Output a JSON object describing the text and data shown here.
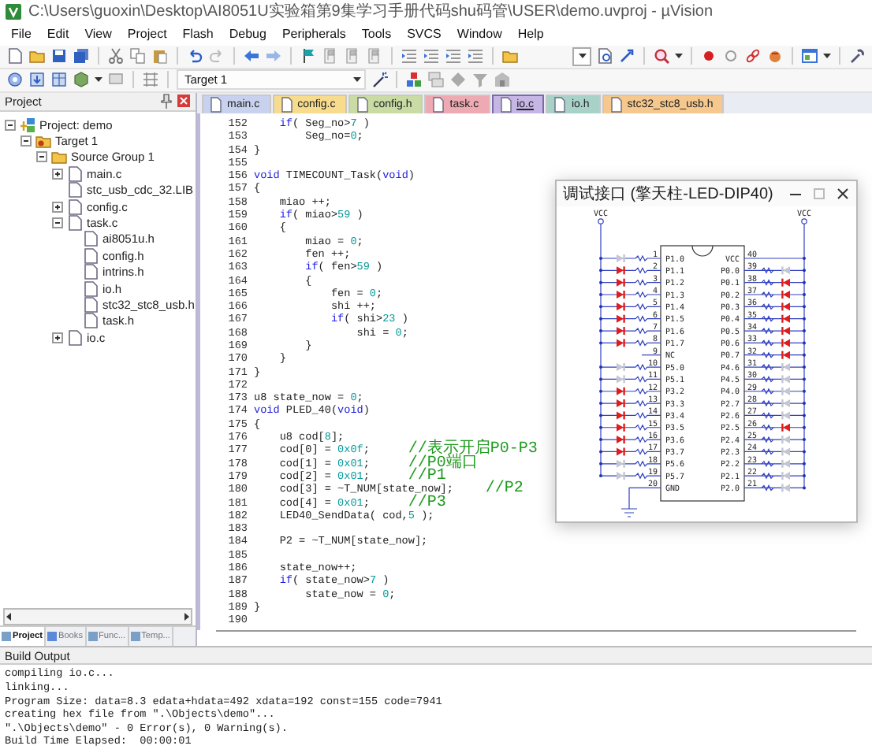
{
  "window": {
    "title": "C:\\Users\\guoxin\\Desktop\\AI8051U实验箱第9集学习手册代码shu码管\\USER\\demo.uvproj - µVision"
  },
  "menu": [
    "File",
    "Edit",
    "View",
    "Project",
    "Flash",
    "Debug",
    "Peripherals",
    "Tools",
    "SVCS",
    "Window",
    "Help"
  ],
  "toolbar": {
    "target": "Target 1"
  },
  "project_panel": {
    "title": "Project",
    "tree": [
      {
        "label": "Project: demo",
        "kind": "project",
        "expanded": true,
        "children": [
          {
            "label": "Target 1",
            "kind": "target",
            "expanded": true,
            "children": [
              {
                "label": "Source Group 1",
                "kind": "group",
                "expanded": true,
                "children": [
                  {
                    "label": "main.c",
                    "kind": "file",
                    "expanded": false
                  },
                  {
                    "label": "stc_usb_cdc_32.LIB",
                    "kind": "file"
                  },
                  {
                    "label": "config.c",
                    "kind": "file",
                    "expanded": false
                  },
                  {
                    "label": "task.c",
                    "kind": "file",
                    "expanded": true,
                    "children": [
                      {
                        "label": "ai8051u.h",
                        "kind": "file"
                      },
                      {
                        "label": "config.h",
                        "kind": "file"
                      },
                      {
                        "label": "intrins.h",
                        "kind": "file"
                      },
                      {
                        "label": "io.h",
                        "kind": "file"
                      },
                      {
                        "label": "stc32_stc8_usb.h",
                        "kind": "file"
                      },
                      {
                        "label": "task.h",
                        "kind": "file"
                      }
                    ]
                  },
                  {
                    "label": "io.c",
                    "kind": "file",
                    "expanded": false
                  }
                ]
              }
            ]
          }
        ]
      }
    ],
    "tabs": [
      {
        "label": "Project",
        "selected": true
      },
      {
        "label": "Books",
        "selected": false
      },
      {
        "label": "Func...",
        "selected": false
      },
      {
        "label": "Temp...",
        "selected": false
      }
    ]
  },
  "editor": {
    "tabs": [
      {
        "label": "main.c",
        "color": "#c8d2ee",
        "selected": false
      },
      {
        "label": "config.c",
        "color": "#f6dc8c",
        "selected": false
      },
      {
        "label": "config.h",
        "color": "#cadca4",
        "selected": false
      },
      {
        "label": "task.c",
        "color": "#eeaab2",
        "selected": false
      },
      {
        "label": "io.c",
        "color": "#c6b6e6",
        "selected": true
      },
      {
        "label": "io.h",
        "color": "#a8d2c8",
        "selected": false
      },
      {
        "label": "stc32_stc8_usb.h",
        "color": "#f6c88e",
        "selected": false
      }
    ],
    "lines": [
      {
        "num": "152",
        "parts": [
          {
            "text": "    if",
            "kind": "kw"
          },
          {
            "text": "( Seg_no>"
          },
          {
            "text": "7",
            "kind": "num"
          },
          {
            "text": " )"
          }
        ]
      },
      {
        "num": "153",
        "parts": [
          {
            "text": "        Seg_no="
          },
          {
            "text": "0",
            "kind": "num"
          },
          {
            "text": ";"
          }
        ]
      },
      {
        "num": "154",
        "parts": [
          {
            "text": "}"
          }
        ]
      },
      {
        "num": "155"
      },
      {
        "num": "156",
        "parts": [
          {
            "text": "void",
            "kind": "kw"
          },
          {
            "text": " TIMECOUNT_Task("
          },
          {
            "text": "void",
            "kind": "kw"
          },
          {
            "text": ")"
          }
        ]
      },
      {
        "num": "157",
        "parts": [
          {
            "text": "{"
          }
        ]
      },
      {
        "num": "158",
        "parts": [
          {
            "text": "    miao ++;"
          }
        ]
      },
      {
        "num": "159",
        "parts": [
          {
            "text": "    if",
            "kind": "kw"
          },
          {
            "text": "( miao>"
          },
          {
            "text": "59",
            "kind": "num"
          },
          {
            "text": " )"
          }
        ]
      },
      {
        "num": "160",
        "parts": [
          {
            "text": "    {"
          }
        ]
      },
      {
        "num": "161",
        "parts": [
          {
            "text": "        miao = "
          },
          {
            "text": "0",
            "kind": "num"
          },
          {
            "text": ";"
          }
        ]
      },
      {
        "num": "162",
        "parts": [
          {
            "text": "        fen ++;"
          }
        ]
      },
      {
        "num": "163",
        "parts": [
          {
            "text": "        if",
            "kind": "kw"
          },
          {
            "text": "( fen>"
          },
          {
            "text": "59",
            "kind": "num"
          },
          {
            "text": " )"
          }
        ]
      },
      {
        "num": "164",
        "parts": [
          {
            "text": "        {"
          }
        ]
      },
      {
        "num": "165",
        "parts": [
          {
            "text": "            fen = "
          },
          {
            "text": "0",
            "kind": "num"
          },
          {
            "text": ";"
          }
        ]
      },
      {
        "num": "166",
        "parts": [
          {
            "text": "            shi ++;"
          }
        ]
      },
      {
        "num": "167",
        "parts": [
          {
            "text": "            if",
            "kind": "kw"
          },
          {
            "text": "( shi>"
          },
          {
            "text": "23",
            "kind": "num"
          },
          {
            "text": " )"
          }
        ]
      },
      {
        "num": "168",
        "parts": [
          {
            "text": "                shi = "
          },
          {
            "text": "0",
            "kind": "num"
          },
          {
            "text": ";"
          }
        ]
      },
      {
        "num": "169",
        "parts": [
          {
            "text": "        }"
          }
        ]
      },
      {
        "num": "170",
        "parts": [
          {
            "text": "    }"
          }
        ]
      },
      {
        "num": "171",
        "parts": [
          {
            "text": "}"
          }
        ]
      },
      {
        "num": "172"
      },
      {
        "num": "173",
        "parts": [
          {
            "text": "u8 state_now = "
          },
          {
            "text": "0",
            "kind": "num"
          },
          {
            "text": ";"
          }
        ]
      },
      {
        "num": "174",
        "parts": [
          {
            "text": "void",
            "kind": "kw"
          },
          {
            "text": " PLED_40("
          },
          {
            "text": "void",
            "kind": "kw"
          },
          {
            "text": ")"
          }
        ]
      },
      {
        "num": "175",
        "parts": [
          {
            "text": "{"
          }
        ]
      },
      {
        "num": "176",
        "parts": [
          {
            "text": "    u8 cod["
          },
          {
            "text": "8",
            "kind": "num"
          },
          {
            "text": "];"
          }
        ]
      },
      {
        "num": "177",
        "parts": [
          {
            "text": "    cod[0] = "
          },
          {
            "text": "0x0f",
            "kind": "num"
          },
          {
            "text": ";      "
          },
          {
            "text": "//表示开启P0-P3",
            "kind": "cm"
          }
        ]
      },
      {
        "num": "178",
        "parts": [
          {
            "text": "    cod[1] = "
          },
          {
            "text": "0x01",
            "kind": "num"
          },
          {
            "text": ";      "
          },
          {
            "text": "//P0端口",
            "kind": "cm"
          }
        ]
      },
      {
        "num": "179",
        "parts": [
          {
            "text": "    cod[2] = "
          },
          {
            "text": "0x01",
            "kind": "num"
          },
          {
            "text": ";      "
          },
          {
            "text": "//P1",
            "kind": "cm"
          }
        ]
      },
      {
        "num": "180",
        "parts": [
          {
            "text": "    cod[3] = ~T_NUM[state_now];     "
          },
          {
            "text": "//P2",
            "kind": "cm"
          }
        ]
      },
      {
        "num": "181",
        "parts": [
          {
            "text": "    cod[4] = "
          },
          {
            "text": "0x01",
            "kind": "num"
          },
          {
            "text": ";      "
          },
          {
            "text": "//P3",
            "kind": "cm"
          }
        ]
      },
      {
        "num": "182",
        "parts": [
          {
            "text": "    LED40_SendData( cod,"
          },
          {
            "text": "5",
            "kind": "num"
          },
          {
            "text": " );"
          }
        ]
      },
      {
        "num": "183"
      },
      {
        "num": "184",
        "parts": [
          {
            "text": "    P2 = ~T_NUM[state_now];"
          }
        ]
      },
      {
        "num": "185"
      },
      {
        "num": "186",
        "parts": [
          {
            "text": "    state_now++;"
          }
        ]
      },
      {
        "num": "187",
        "parts": [
          {
            "text": "    if",
            "kind": "kw"
          },
          {
            "text": "( state_now>"
          },
          {
            "text": "7",
            "kind": "num"
          },
          {
            "text": " )"
          }
        ]
      },
      {
        "num": "188",
        "parts": [
          {
            "text": "        state_now = "
          },
          {
            "text": "0",
            "kind": "num"
          },
          {
            "text": ";"
          }
        ]
      },
      {
        "num": "189",
        "parts": [
          {
            "text": "}"
          }
        ]
      },
      {
        "num": "190"
      }
    ]
  },
  "dialog": {
    "title": "调试接口 (擎天柱-LED-DIP40)",
    "supply_labels": [
      "VCC",
      "VCC"
    ],
    "left_pins": [
      {
        "num": "1",
        "label": "P1.0",
        "kind": "led",
        "lit": false
      },
      {
        "num": "2",
        "label": "P1.1",
        "kind": "led",
        "lit": true
      },
      {
        "num": "3",
        "label": "P1.2",
        "kind": "led",
        "lit": true
      },
      {
        "num": "4",
        "label": "P1.3",
        "kind": "led",
        "lit": true
      },
      {
        "num": "5",
        "label": "P1.4",
        "kind": "led",
        "lit": true
      },
      {
        "num": "6",
        "label": "P1.5",
        "kind": "led",
        "lit": true
      },
      {
        "num": "7",
        "label": "P1.6",
        "kind": "led",
        "lit": true
      },
      {
        "num": "8",
        "label": "P1.7",
        "kind": "led",
        "lit": true
      },
      {
        "num": "9",
        "label": "NC",
        "kind": "nc"
      },
      {
        "num": "10",
        "label": "P5.0",
        "kind": "led",
        "lit": false
      },
      {
        "num": "11",
        "label": "P5.1",
        "kind": "led",
        "lit": false
      },
      {
        "num": "12",
        "label": "P3.2",
        "kind": "led",
        "lit": true
      },
      {
        "num": "13",
        "label": "P3.3",
        "kind": "led",
        "lit": true
      },
      {
        "num": "14",
        "label": "P3.4",
        "kind": "led",
        "lit": true
      },
      {
        "num": "15",
        "label": "P3.5",
        "kind": "led",
        "lit": true
      },
      {
        "num": "16",
        "label": "P3.6",
        "kind": "led",
        "lit": true
      },
      {
        "num": "17",
        "label": "P3.7",
        "kind": "led",
        "lit": true
      },
      {
        "num": "18",
        "label": "P5.6",
        "kind": "led",
        "lit": false
      },
      {
        "num": "19",
        "label": "P5.7",
        "kind": "led",
        "lit": false
      },
      {
        "num": "20",
        "label": "GND",
        "kind": "ground"
      }
    ],
    "right_pins": [
      {
        "num": "40",
        "label": "VCC",
        "kind": "power"
      },
      {
        "num": "39",
        "label": "P0.0",
        "kind": "led",
        "lit": false
      },
      {
        "num": "38",
        "label": "P0.1",
        "kind": "led",
        "lit": true
      },
      {
        "num": "37",
        "label": "P0.2",
        "kind": "led",
        "lit": true
      },
      {
        "num": "36",
        "label": "P0.3",
        "kind": "led",
        "lit": true
      },
      {
        "num": "35",
        "label": "P0.4",
        "kind": "led",
        "lit": true
      },
      {
        "num": "34",
        "label": "P0.5",
        "kind": "led",
        "lit": true
      },
      {
        "num": "33",
        "label": "P0.6",
        "kind": "led",
        "lit": true
      },
      {
        "num": "32",
        "label": "P0.7",
        "kind": "led",
        "lit": true
      },
      {
        "num": "31",
        "label": "P4.6",
        "kind": "led",
        "lit": false
      },
      {
        "num": "30",
        "label": "P4.5",
        "kind": "led",
        "lit": false
      },
      {
        "num": "29",
        "label": "P4.0",
        "kind": "led",
        "lit": false
      },
      {
        "num": "28",
        "label": "P2.7",
        "kind": "led",
        "lit": false
      },
      {
        "num": "27",
        "label": "P2.6",
        "kind": "led",
        "lit": false
      },
      {
        "num": "26",
        "label": "P2.5",
        "kind": "led",
        "lit": true
      },
      {
        "num": "25",
        "label": "P2.4",
        "kind": "led",
        "lit": false
      },
      {
        "num": "24",
        "label": "P2.3",
        "kind": "led",
        "lit": false
      },
      {
        "num": "23",
        "label": "P2.2",
        "kind": "led",
        "lit": false
      },
      {
        "num": "22",
        "label": "P2.1",
        "kind": "led",
        "lit": false
      },
      {
        "num": "21",
        "label": "P2.0",
        "kind": "led",
        "lit": false
      }
    ]
  },
  "build_output": {
    "title": "Build Output",
    "lines": [
      "compiling io.c...",
      "linking...",
      "Program Size: data=8.3 edata+hdata=492 xdata=192 const=155 code=7941",
      "creating hex file from \".\\Objects\\demo\"...",
      "\".\\Objects\\demo\" - 0 Error(s), 0 Warning(s).",
      "Build Time Elapsed:  00:00:01"
    ]
  }
}
